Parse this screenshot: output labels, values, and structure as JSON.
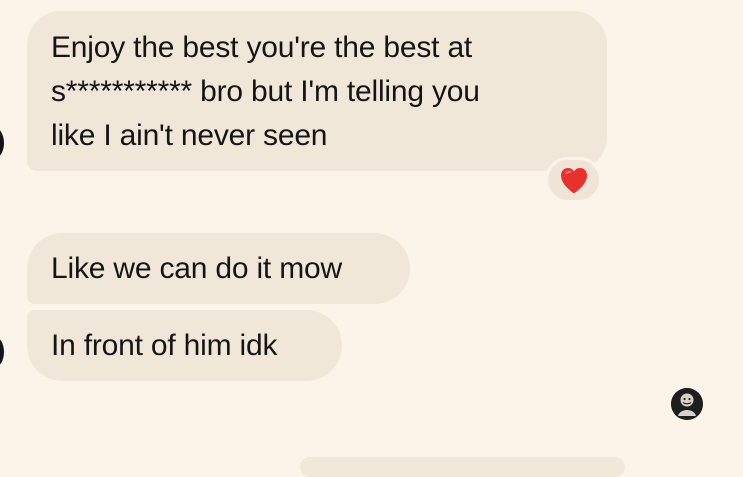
{
  "messages": [
    {
      "text": "Enjoy the best you're the best at\ns*********** bro but I'm telling you\nlike I ain't never seen",
      "reaction_icon": "red-heart-icon"
    },
    {
      "text": "Like we can do it mow"
    },
    {
      "text": "In front of him idk"
    }
  ],
  "icons": {
    "incoming_avatar": "avatar-icon",
    "read_receipt_avatar": "read-receipt-avatar-icon",
    "reaction": "red-heart-icon"
  },
  "colors": {
    "background": "#fcf4e9",
    "bubble": "#f1e7d9",
    "text": "#151515",
    "heart": "#e8312d"
  }
}
